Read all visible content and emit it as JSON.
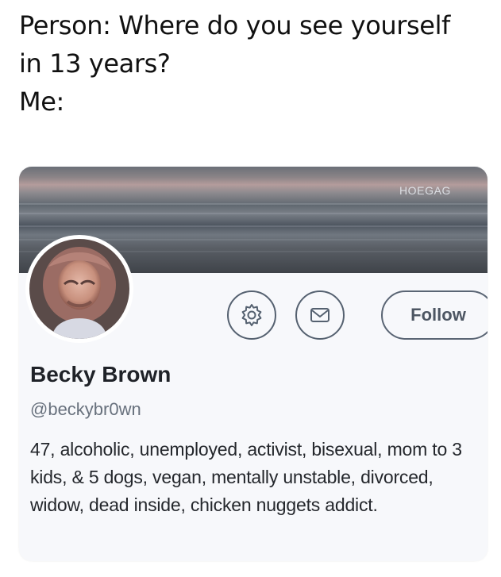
{
  "meme": {
    "line1": "Person: Where do you see yourself",
    "line2": "in 13 years?",
    "line3": "Me:"
  },
  "card": {
    "watermark": "HOEGAG",
    "name": "Becky Brown",
    "handle": "@beckybr0wn",
    "bio": "47, alcoholic, unemployed, activist, bisexual, mom to 3 kids, & 5 dogs, vegan, mentally unstable, divorced, widow, dead inside, chicken nuggets addict.",
    "follow_label": "Follow",
    "icons": [
      "gear-icon",
      "mail-icon"
    ]
  },
  "colors": {
    "text": "#111111",
    "handle": "#68717d",
    "button_border": "#556170"
  }
}
